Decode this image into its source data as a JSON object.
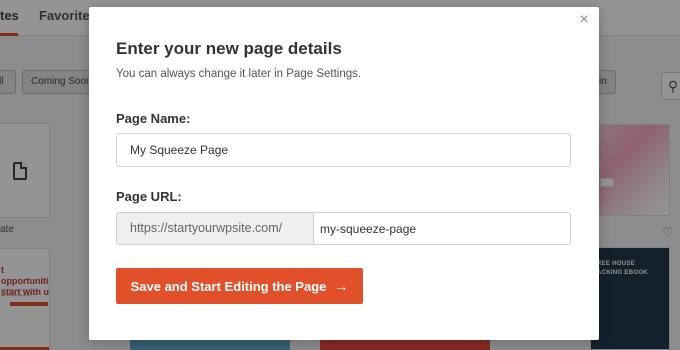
{
  "background": {
    "tabs": [
      {
        "label": "tes"
      },
      {
        "label": "Favorite"
      }
    ],
    "chips": [
      {
        "label": "ll"
      },
      {
        "label": "Coming Soon"
      },
      {
        "label": "in"
      }
    ],
    "blank_card_label": "ate",
    "promo_text": "t opportunities\nstart with us!",
    "ebook_title": "REE HOUSE\nACKING EBOOK"
  },
  "modal": {
    "title": "Enter your new page details",
    "subtitle": "You can always change it later in Page Settings.",
    "page_name_label": "Page Name:",
    "page_name_value": "My Squeeze Page",
    "page_url_label": "Page URL:",
    "url_prefix": "https://startyourwpsite.com/",
    "url_slug_value": "my-squeeze-page",
    "submit_label": "Save and Start Editing the Page",
    "submit_arrow": "→",
    "close_glyph": "×"
  },
  "colors": {
    "accent": "#e0502a",
    "overlay": "rgba(0,0,0,0.42)"
  },
  "icons": {
    "close": "close-icon",
    "arrow": "arrow-right-icon",
    "blank_page": "document-icon",
    "search": "search-icon",
    "heart": "heart-icon"
  }
}
